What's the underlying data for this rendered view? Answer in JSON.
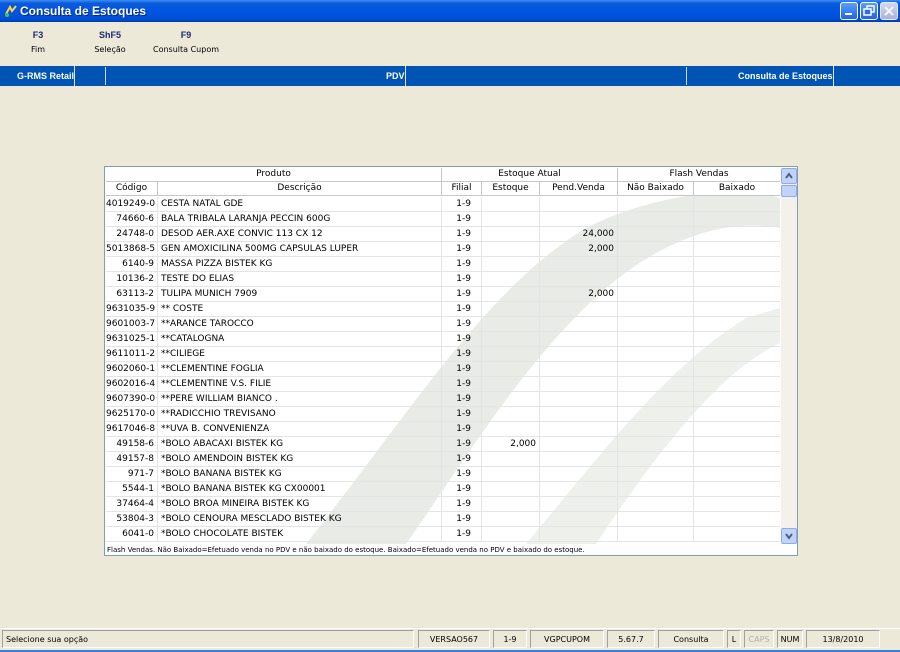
{
  "window": {
    "title": "Consulta de Estoques",
    "accent": "#0054E3",
    "band_color": "#0054B4"
  },
  "fkeys": [
    {
      "key": "F3",
      "label": "Fim"
    },
    {
      "key": "ShF5",
      "label": "Seleção"
    },
    {
      "key": "F9",
      "label": "Consulta Cupom"
    }
  ],
  "band": {
    "left": "G-RMS Retail",
    "center": "PDV",
    "right": "Consulta de Estoques"
  },
  "grid": {
    "group_headers": {
      "produto": "Produto",
      "estoque_atual": "Estoque Atual",
      "flash_vendas": "Flash Vendas"
    },
    "columns": {
      "codigo": "Código",
      "descricao": "Descrição",
      "filial": "Filial",
      "estoque": "Estoque",
      "pend_venda": "Pend.Venda",
      "nao_baixado": "Não Baixado",
      "baixado": "Baixado"
    },
    "rows": [
      {
        "codigo": "4019249-0",
        "descricao": "CESTA NATAL GDE",
        "filial": "1-9",
        "estoque": "",
        "pend": "",
        "nb": "",
        "b": ""
      },
      {
        "codigo": "74660-6",
        "descricao": "BALA TRIBALA LARANJA PECCIN 600G",
        "filial": "1-9",
        "estoque": "",
        "pend": "",
        "nb": "",
        "b": ""
      },
      {
        "codigo": "24748-0",
        "descricao": "DESOD AER.AXE CONVIC 113 CX 12",
        "filial": "1-9",
        "estoque": "",
        "pend": "24,000",
        "nb": "",
        "b": ""
      },
      {
        "codigo": "5013868-5",
        "descricao": "GEN AMOXICILINA 500MG CAPSULAS LUPER",
        "filial": "1-9",
        "estoque": "",
        "pend": "2,000",
        "nb": "",
        "b": ""
      },
      {
        "codigo": "6140-9",
        "descricao": "MASSA PIZZA BISTEK KG",
        "filial": "1-9",
        "estoque": "",
        "pend": "",
        "nb": "",
        "b": ""
      },
      {
        "codigo": "10136-2",
        "descricao": "TESTE DO ELIAS",
        "filial": "1-9",
        "estoque": "",
        "pend": "",
        "nb": "",
        "b": ""
      },
      {
        "codigo": "63113-2",
        "descricao": "TULIPA MUNICH 7909",
        "filial": "1-9",
        "estoque": "",
        "pend": "2,000",
        "nb": "",
        "b": ""
      },
      {
        "codigo": "9631035-9",
        "descricao": "** COSTE",
        "filial": "1-9",
        "estoque": "",
        "pend": "",
        "nb": "",
        "b": ""
      },
      {
        "codigo": "9601003-7",
        "descricao": "**ARANCE TAROCCO",
        "filial": "1-9",
        "estoque": "",
        "pend": "",
        "nb": "",
        "b": ""
      },
      {
        "codigo": "9631025-1",
        "descricao": "**CATALOGNA",
        "filial": "1-9",
        "estoque": "",
        "pend": "",
        "nb": "",
        "b": ""
      },
      {
        "codigo": "9611011-2",
        "descricao": "**CILIEGE",
        "filial": "1-9",
        "estoque": "",
        "pend": "",
        "nb": "",
        "b": ""
      },
      {
        "codigo": "9602060-1",
        "descricao": "**CLEMENTINE FOGLIA",
        "filial": "1-9",
        "estoque": "",
        "pend": "",
        "nb": "",
        "b": ""
      },
      {
        "codigo": "9602016-4",
        "descricao": "**CLEMENTINE V.S. FILIE",
        "filial": "1-9",
        "estoque": "",
        "pend": "",
        "nb": "",
        "b": ""
      },
      {
        "codigo": "9607390-0",
        "descricao": "**PERE WILLIAM BIANCO .",
        "filial": "1-9",
        "estoque": "",
        "pend": "",
        "nb": "",
        "b": ""
      },
      {
        "codigo": "9625170-0",
        "descricao": "**RADICCHIO TREVISANO",
        "filial": "1-9",
        "estoque": "",
        "pend": "",
        "nb": "",
        "b": ""
      },
      {
        "codigo": "9617046-8",
        "descricao": "**UVA B. CONVENIENZA",
        "filial": "1-9",
        "estoque": "",
        "pend": "",
        "nb": "",
        "b": ""
      },
      {
        "codigo": "49158-6",
        "descricao": "*BOLO ABACAXI BISTEK KG",
        "filial": "1-9",
        "estoque": "2,000",
        "pend": "",
        "nb": "",
        "b": ""
      },
      {
        "codigo": "49157-8",
        "descricao": "*BOLO AMENDOIN BISTEK KG",
        "filial": "1-9",
        "estoque": "",
        "pend": "",
        "nb": "",
        "b": ""
      },
      {
        "codigo": "971-7",
        "descricao": "*BOLO BANANA BISTEK KG",
        "filial": "1-9",
        "estoque": "",
        "pend": "",
        "nb": "",
        "b": ""
      },
      {
        "codigo": "5544-1",
        "descricao": "*BOLO BANANA BISTEK KG CX00001",
        "filial": "1-9",
        "estoque": "",
        "pend": "",
        "nb": "",
        "b": ""
      },
      {
        "codigo": "37464-4",
        "descricao": "*BOLO BROA MINEIRA BISTEK KG",
        "filial": "1-9",
        "estoque": "",
        "pend": "",
        "nb": "",
        "b": ""
      },
      {
        "codigo": "53804-3",
        "descricao": "*BOLO CENOURA MESCLADO BISTEK KG",
        "filial": "1-9",
        "estoque": "",
        "pend": "",
        "nb": "",
        "b": ""
      },
      {
        "codigo": "6041-0",
        "descricao": "*BOLO CHOCOLATE BISTEK",
        "filial": "1-9",
        "estoque": "",
        "pend": "",
        "nb": "",
        "b": ""
      }
    ],
    "legend": "Flash Vendas. Não Baixado=Efetuado venda no PDV e não baixado do estoque. Baixado=Efetuado venda no PDV e baixado do estoque."
  },
  "statusbar": {
    "message": "Selecione sua opção",
    "version": "VERSAO567",
    "filial": "1-9",
    "db": "VGPCUPOM",
    "build": "5.67.7",
    "mode": "Consulta",
    "l": "L",
    "caps": "CAPS",
    "num": "NUM",
    "date": "13/8/2010"
  }
}
